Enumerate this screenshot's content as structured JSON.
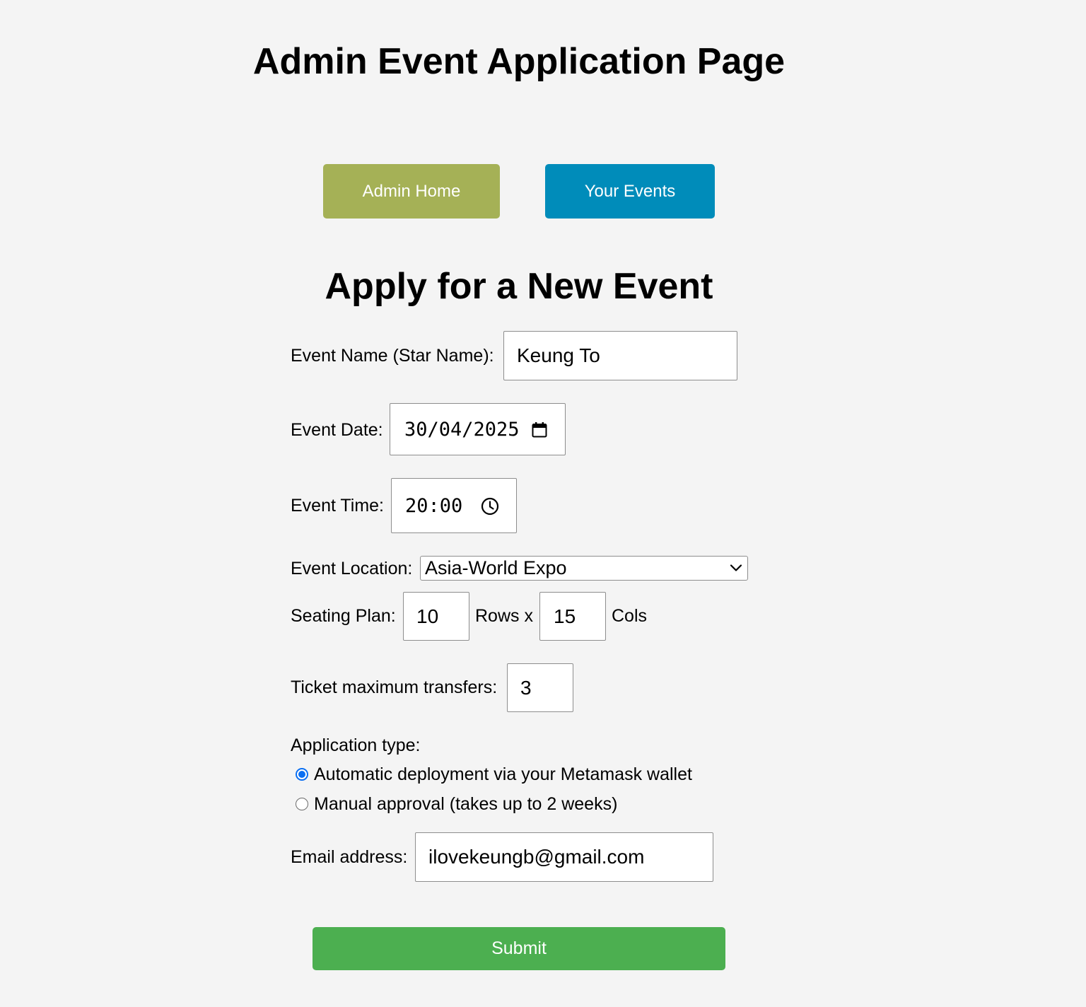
{
  "page": {
    "title": "Admin Event Application Page"
  },
  "nav": {
    "admin_home_label": "Admin Home",
    "your_events_label": "Your Events",
    "admin_home_color": "#a5b156",
    "your_events_color": "#008cba"
  },
  "form": {
    "title": "Apply for a New Event",
    "event_name": {
      "label": "Event Name (Star Name):",
      "value": "Keung To"
    },
    "event_date": {
      "label": "Event Date:",
      "value": "30/04/2025",
      "icon": "calendar-icon"
    },
    "event_time": {
      "label": "Event Time:",
      "value": "20:00",
      "icon": "clock-icon"
    },
    "event_location": {
      "label": "Event Location:",
      "selected": "Asia-World Expo",
      "icon": "chevron-down-icon"
    },
    "seating": {
      "label": "Seating Plan:",
      "rows_value": "10",
      "rows_label": "Rows x",
      "cols_value": "15",
      "cols_label": "Cols"
    },
    "max_transfers": {
      "label": "Ticket maximum transfers:",
      "value": "3"
    },
    "application_type": {
      "label": "Application type:",
      "options": [
        {
          "label": "Automatic deployment via your Metamask wallet",
          "checked": true
        },
        {
          "label": "Manual approval (takes up to 2 weeks)",
          "checked": false
        }
      ]
    },
    "email": {
      "label": "Email address:",
      "value": "ilovekeungb@gmail.com"
    },
    "submit_label": "Submit",
    "submit_color": "#4caf50",
    "radio_accent_color": "#0b6ff2"
  }
}
